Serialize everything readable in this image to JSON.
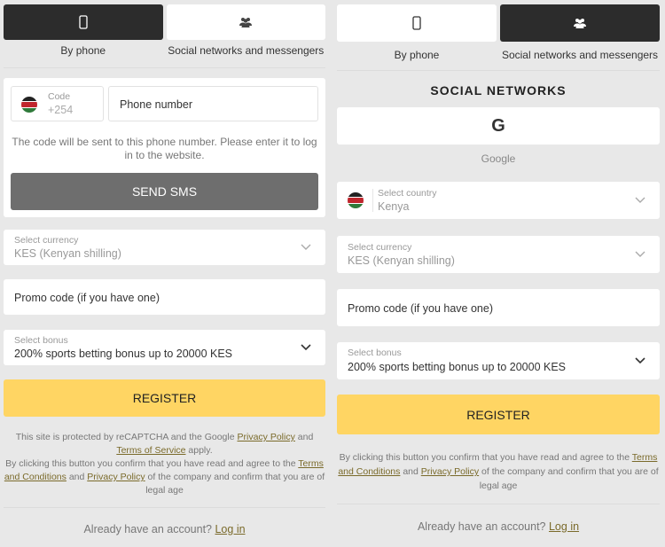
{
  "tabs": [
    {
      "label": "By phone",
      "icon": "smartphone-icon"
    },
    {
      "label": "Social networks and messengers",
      "icon": "users-icon"
    }
  ],
  "left": {
    "code_label": "Code",
    "code_value": "+254",
    "phone_placeholder": "Phone number",
    "sms_hint": "The code will be sent to this phone number. Please enter it to log in to the website.",
    "send_sms_label": "SEND SMS",
    "currency_label": "Select currency",
    "currency_value": "KES  (Kenyan shilling)",
    "promo_placeholder": "Promo code (if you have one)",
    "bonus_label": "Select bonus",
    "bonus_value": "200% sports betting bonus up to 20000 KES",
    "register_label": "REGISTER",
    "recaptcha_text_1": "This site is protected by reCAPTCHA and the Google ",
    "privacy_policy": "Privacy Policy",
    "and": " and ",
    "terms_of_service": "Terms of Service",
    "apply": " apply.",
    "consent_1": "By clicking this button you confirm that you have read and agree to the ",
    "terms_and_conditions": "Terms and Conditions",
    "consent_2": " of the company and confirm that you are of legal age",
    "already_text": "Already have an account? ",
    "login_link": "Log in"
  },
  "right": {
    "section_title": "SOCIAL NETWORKS",
    "google_label": "Google",
    "country_label": "Select country",
    "country_value": "Kenya",
    "currency_label": "Select currency",
    "currency_value": "KES  (Kenyan shilling)",
    "promo_placeholder": "Promo code (if you have one)",
    "bonus_label": "Select bonus",
    "bonus_value": "200% sports betting bonus up to 20000 KES",
    "register_label": "REGISTER",
    "consent_1": "By clicking this button you confirm that you have read and agree to the ",
    "terms_and_conditions": "Terms and Conditions",
    "and": " and ",
    "privacy_policy": "Privacy Policy",
    "consent_2": " of the company and confirm that you are of legal age",
    "already_text": "Already have an account? ",
    "login_link": "Log in"
  },
  "colors": {
    "accent_yellow": "#ffd563",
    "active_tab": "#2c2c2c",
    "send_sms_button": "#6e6e6e",
    "link": "#7a6a2a"
  }
}
